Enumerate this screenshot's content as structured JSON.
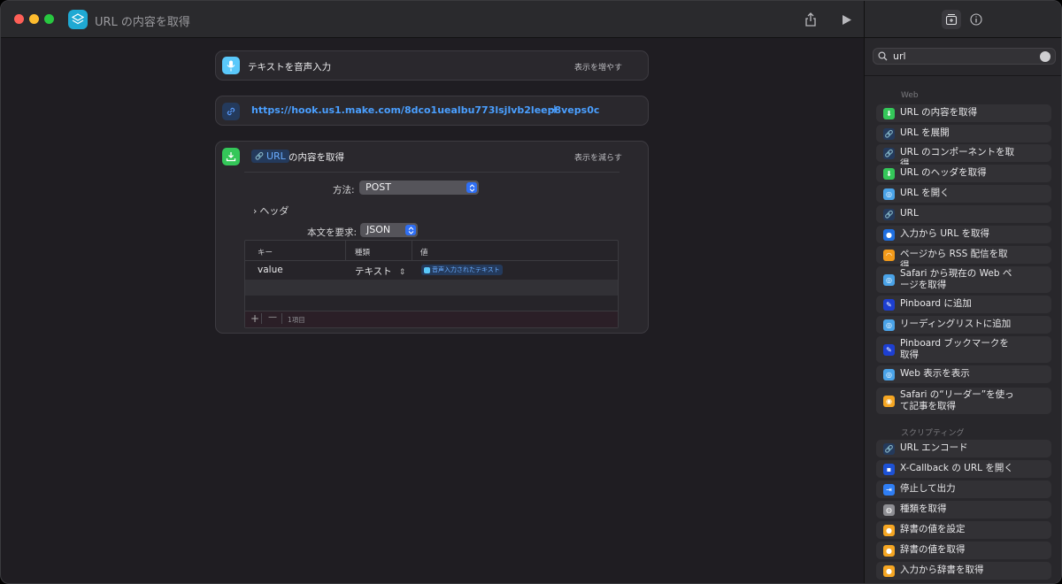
{
  "window": {
    "title": "URL の内容を取得"
  },
  "editor": {
    "dictate_card": {
      "title": "テキストを音声入力",
      "toggle": "表示を増やす"
    },
    "url_card": {
      "url": "https://hook.us1.make.com/8dco1uealbu773lsjlvb2leep8veps0c",
      "add": "+"
    },
    "get_card": {
      "token": "URL",
      "title_suffix": "の内容を取得",
      "toggle": "表示を減らす",
      "method_label": "方法:",
      "method_value": "POST",
      "headers_label": "ヘッダ",
      "body_label": "本文を要求:",
      "body_value": "JSON",
      "table": {
        "headers": [
          "キー",
          "種類",
          "値"
        ],
        "rows": [
          {
            "key": "value",
            "type": "テキスト",
            "value": "音声入力されたテキスト"
          }
        ],
        "add": "+",
        "remove": "—",
        "count": "1項目"
      }
    }
  },
  "library": {
    "search": {
      "value": "url"
    },
    "sections": [
      {
        "title": "Web",
        "items": [
          {
            "label": "URL の内容を取得",
            "icon": "download-icon",
            "color": "#34c759"
          },
          {
            "label": "URL を展開",
            "icon": "link-icon",
            "color": "#243a5c"
          },
          {
            "label": "URL のコンポーネントを取得",
            "icon": "link-icon",
            "color": "#243a5c"
          },
          {
            "label": "URL のヘッダを取得",
            "icon": "download-icon",
            "color": "#34c759"
          },
          {
            "label": "URL を開く",
            "icon": "safari-icon",
            "color": "#4aa3e8"
          },
          {
            "label": "URL",
            "icon": "link-icon",
            "color": "#243a5c"
          },
          {
            "label": "入力から URL を取得",
            "icon": "globe-icon",
            "color": "#1f6fe0"
          },
          {
            "label": "ページから RSS 配信を取得",
            "icon": "rss-icon",
            "color": "#f29a1a"
          },
          {
            "label": "Safari から現在の Web ページを取得",
            "icon": "safari-icon",
            "color": "#4aa3e8"
          },
          {
            "label": "Pinboard に追加",
            "icon": "pin-icon",
            "color": "#1d3fd1"
          },
          {
            "label": "リーディングリストに追加",
            "icon": "safari-icon",
            "color": "#4aa3e8"
          },
          {
            "label": "Pinboard ブックマークを取得",
            "icon": "pin-icon",
            "color": "#1d3fd1"
          },
          {
            "label": "Web 表示を表示",
            "icon": "safari-icon",
            "color": "#4aa3e8"
          },
          {
            "label": "Safari の“リーダー”を使って記事を取得",
            "icon": "reader-icon",
            "color": "#f5a623"
          }
        ]
      },
      {
        "title": "スクリプティング",
        "items": [
          {
            "label": "URL エンコード",
            "icon": "link-icon",
            "color": "#243a5c"
          },
          {
            "label": "X-Callback の URL を開く",
            "icon": "callback-icon",
            "color": "#1d52d6"
          },
          {
            "label": "停止して出力",
            "icon": "stop-icon",
            "color": "#2f7ef5"
          },
          {
            "label": "種類を取得",
            "icon": "type-icon",
            "color": "#8e8e93"
          },
          {
            "label": "辞書の値を設定",
            "icon": "dictionary-icon",
            "color": "#f5a623"
          },
          {
            "label": "辞書の値を取得",
            "icon": "dictionary-icon",
            "color": "#f5a623"
          },
          {
            "label": "入力から辞書を取得",
            "icon": "dictionary-icon",
            "color": "#f5a623"
          }
        ]
      }
    ]
  }
}
